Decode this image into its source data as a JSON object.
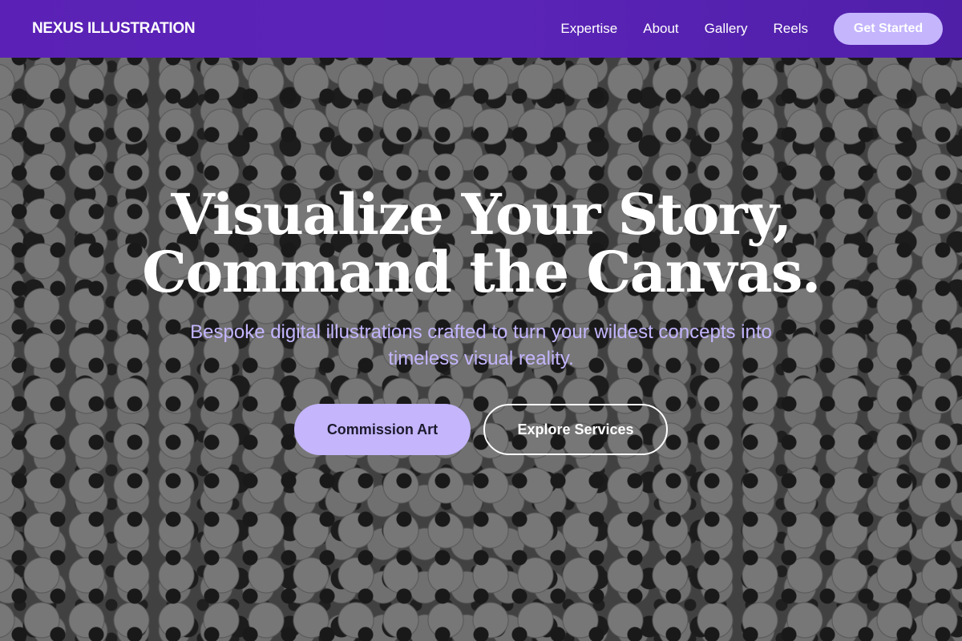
{
  "nav": {
    "brand": "NEXUS ILLUSTRATION",
    "links": [
      "Expertise",
      "About",
      "Gallery",
      "Reels"
    ],
    "cta_label": "Get Started"
  },
  "hero": {
    "title_line1": "Visualize Your Story,",
    "title_line2": "Command the Canvas.",
    "subtitle": "Bespoke digital illustrations crafted to turn your wildest concepts into timeless visual reality.",
    "primary_button": "Commission Art",
    "secondary_button": "Explore Services",
    "background_image": "doodle-pattern"
  },
  "colors": {
    "navbar": "#5b21b6",
    "accent": "#c4b5fd",
    "text_light": "#ffffff"
  }
}
